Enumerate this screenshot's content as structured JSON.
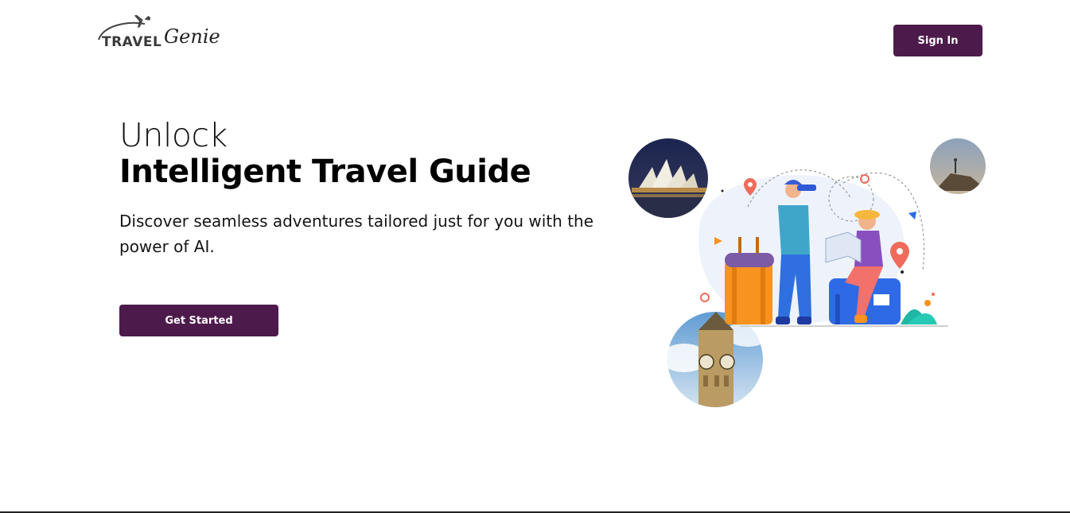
{
  "header": {
    "logo": {
      "word1": "TRAVEL",
      "word2": "Genie",
      "icon": "airplane-icon"
    },
    "signin_label": "Sign In"
  },
  "hero": {
    "line1": "Unlock",
    "line2": "Intelligent Travel Guide",
    "subtitle": "Discover seamless adventures tailored just for you with the power of AI.",
    "cta_label": "Get Started"
  },
  "illustration": {
    "photos": [
      "sydney-opera-house-photo",
      "mountain-summit-photo",
      "big-ben-photo"
    ],
    "scene": "travelers-with-luggage-illustration"
  },
  "colors": {
    "primary": "#4d1a4c",
    "background": "#ffffff",
    "text": "#111111"
  }
}
